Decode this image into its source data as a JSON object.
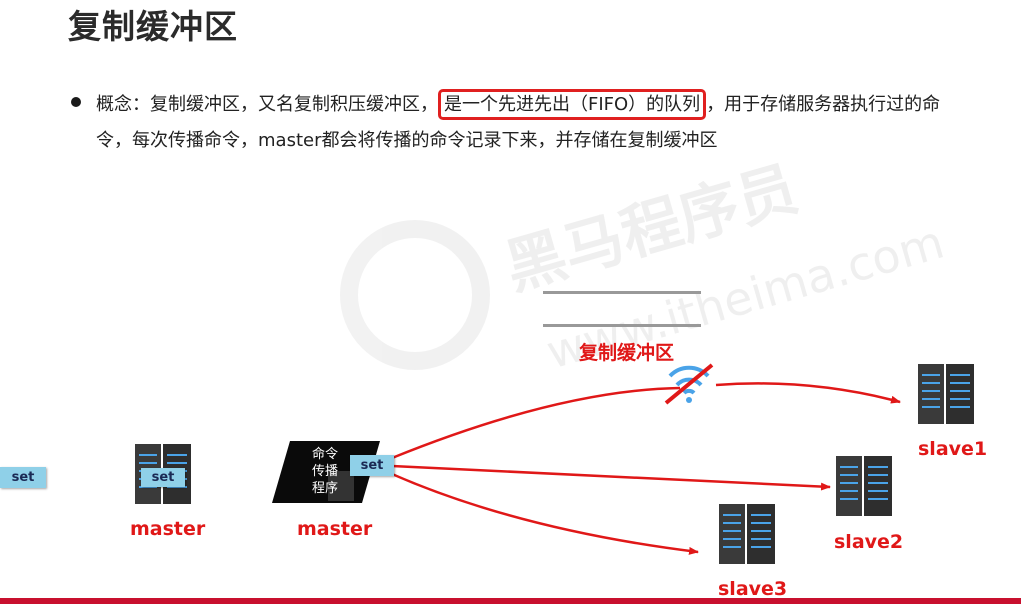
{
  "title": "复制缓冲区",
  "concept": {
    "line1_before": "概念：复制缓冲区，又名复制积压缓冲区，",
    "line1_highlight": "是一个先进先出（FIFO）的队列",
    "line1_after": "，用于存储服务器执行过的命",
    "line2": "令，每次传播命令，master都会将传播的命令记录下来，并存储在复制缓冲区"
  },
  "diagram": {
    "buffer_label": "复制缓冲区",
    "command": "set",
    "master_label": "master",
    "program_lines": [
      "命令",
      "传播",
      "程序"
    ],
    "slaves": [
      "slave1",
      "slave2",
      "slave3"
    ],
    "icons": [
      "server-icon",
      "wifi-off-icon",
      "arrow-icon"
    ],
    "colors": {
      "accent": "#e01818",
      "tag": "#8fd0e8",
      "rule": "#c8102e"
    }
  }
}
